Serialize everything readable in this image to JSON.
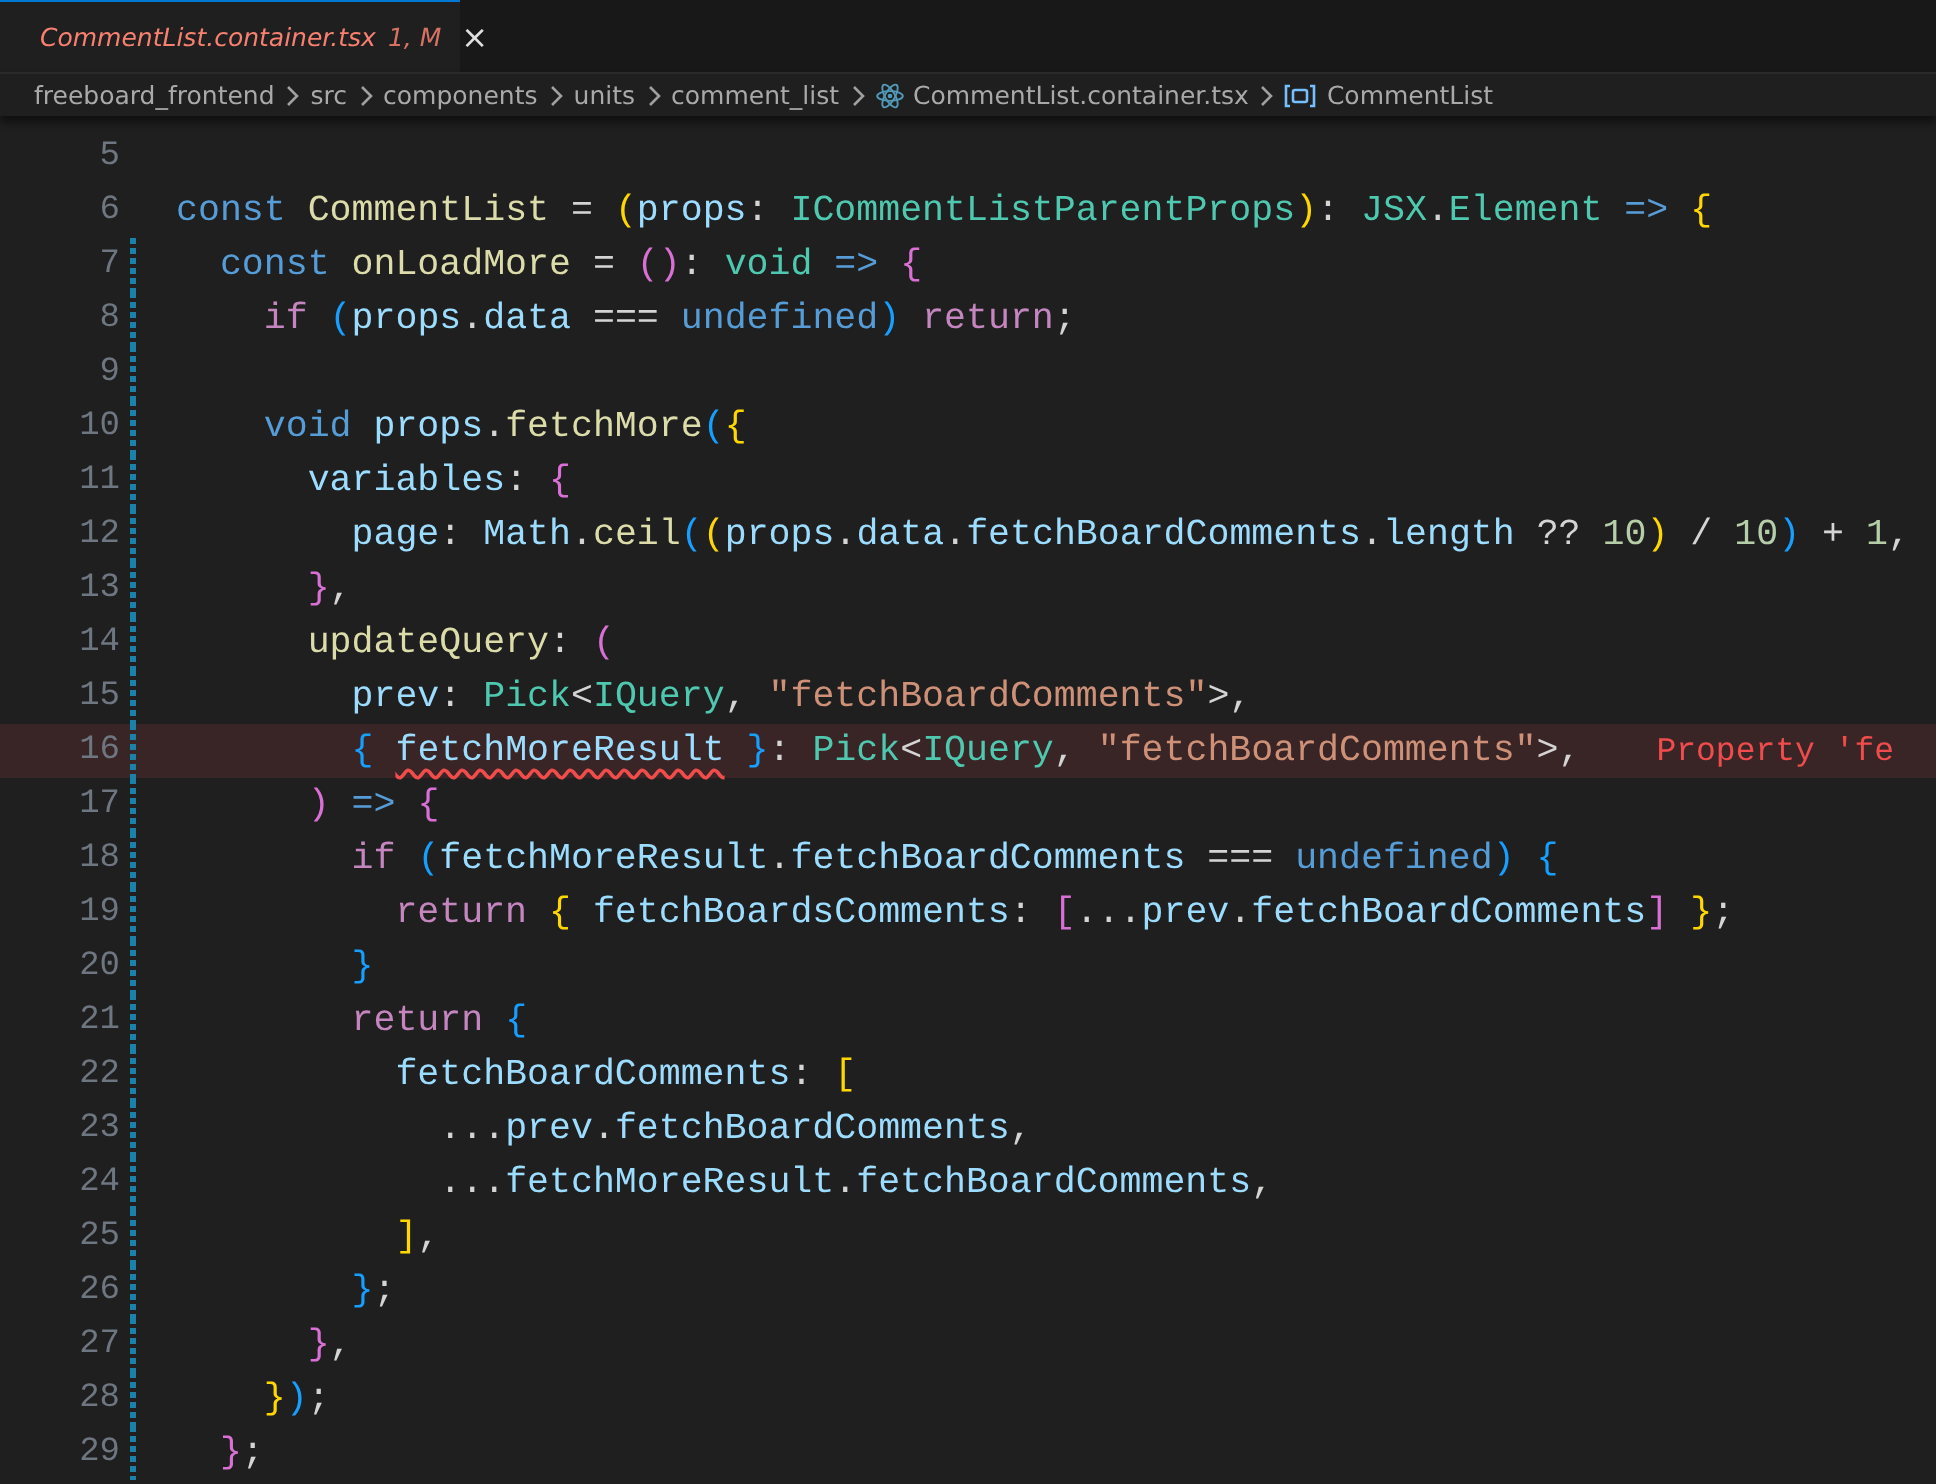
{
  "tab": {
    "title": "CommentList.container.tsx",
    "badge": "1, M",
    "close": "×",
    "selected": true
  },
  "breadcrumb": [
    {
      "label": "freeboard_frontend",
      "kind": "folder"
    },
    {
      "label": "src",
      "kind": "folder"
    },
    {
      "label": "components",
      "kind": "folder"
    },
    {
      "label": "units",
      "kind": "folder"
    },
    {
      "label": "comment_list",
      "kind": "folder"
    },
    {
      "label": "CommentList.container.tsx",
      "kind": "file"
    },
    {
      "label": "CommentList",
      "kind": "symbol"
    }
  ],
  "lines": [
    {
      "number": "5",
      "modified": false,
      "highlighted": false
    },
    {
      "number": "6",
      "modified": false,
      "highlighted": false,
      "tokens": [
        {
          "text": "const",
          "kind": "kw"
        },
        {
          "text": " CommentList",
          "kind": "fn"
        },
        {
          "text": " = ",
          "kind": "plain"
        },
        {
          "text": "(",
          "kind": "b1"
        },
        {
          "text": "props",
          "kind": "var"
        },
        {
          "text": ": ",
          "kind": "plain"
        },
        {
          "text": "ICommentListParentProps",
          "kind": "type"
        },
        {
          "text": ")",
          "kind": "b1"
        },
        {
          "text": ": ",
          "kind": "plain"
        },
        {
          "text": "JSX",
          "kind": "type"
        },
        {
          "text": ".",
          "kind": "plain"
        },
        {
          "text": "Element",
          "kind": "type"
        },
        {
          "text": " =>",
          "kind": "kw"
        },
        {
          "text": " {",
          "kind": "b1"
        }
      ]
    },
    {
      "number": "7",
      "modified": true,
      "highlighted": false,
      "tokens": [
        {
          "text": "  const",
          "kind": "kw"
        },
        {
          "text": " onLoadMore",
          "kind": "fn"
        },
        {
          "text": " = ",
          "kind": "plain"
        },
        {
          "text": "()",
          "kind": "b2"
        },
        {
          "text": ": ",
          "kind": "plain"
        },
        {
          "text": "void",
          "kind": "type"
        },
        {
          "text": " =>",
          "kind": "kw"
        },
        {
          "text": " {",
          "kind": "b2"
        }
      ]
    },
    {
      "number": "8",
      "modified": true,
      "highlighted": false,
      "tokens": [
        {
          "text": "    if",
          "kind": "ctl"
        },
        {
          "text": " (",
          "kind": "b3"
        },
        {
          "text": "props",
          "kind": "var"
        },
        {
          "text": ".",
          "kind": "plain"
        },
        {
          "text": "data",
          "kind": "var"
        },
        {
          "text": " === ",
          "kind": "plain"
        },
        {
          "text": "undefined",
          "kind": "kw"
        },
        {
          "text": ")",
          "kind": "b3"
        },
        {
          "text": " return",
          "kind": "ctl"
        },
        {
          "text": ";",
          "kind": "plain"
        }
      ]
    },
    {
      "number": "9",
      "modified": true,
      "highlighted": false
    },
    {
      "number": "10",
      "modified": true,
      "highlighted": false,
      "tokens": [
        {
          "text": "    void",
          "kind": "kw"
        },
        {
          "text": " props",
          "kind": "var"
        },
        {
          "text": ".",
          "kind": "plain"
        },
        {
          "text": "fetchMore",
          "kind": "fn"
        },
        {
          "text": "(",
          "kind": "b3"
        },
        {
          "text": "{",
          "kind": "b1"
        }
      ]
    },
    {
      "number": "11",
      "modified": true,
      "highlighted": false,
      "tokens": [
        {
          "text": "      variables",
          "kind": "var"
        },
        {
          "text": ": ",
          "kind": "plain"
        },
        {
          "text": "{",
          "kind": "b2"
        }
      ]
    },
    {
      "number": "12",
      "modified": true,
      "highlighted": false,
      "tokens": [
        {
          "text": "        page",
          "kind": "var"
        },
        {
          "text": ": ",
          "kind": "plain"
        },
        {
          "text": "Math",
          "kind": "var"
        },
        {
          "text": ".",
          "kind": "plain"
        },
        {
          "text": "ceil",
          "kind": "fn"
        },
        {
          "text": "(",
          "kind": "b3"
        },
        {
          "text": "(",
          "kind": "b1"
        },
        {
          "text": "props",
          "kind": "var"
        },
        {
          "text": ".",
          "kind": "plain"
        },
        {
          "text": "data",
          "kind": "var"
        },
        {
          "text": ".",
          "kind": "plain"
        },
        {
          "text": "fetchBoardComments",
          "kind": "var"
        },
        {
          "text": ".",
          "kind": "plain"
        },
        {
          "text": "length",
          "kind": "var"
        },
        {
          "text": " ?? ",
          "kind": "plain"
        },
        {
          "text": "10",
          "kind": "num"
        },
        {
          "text": ")",
          "kind": "b1"
        },
        {
          "text": " / ",
          "kind": "plain"
        },
        {
          "text": "10",
          "kind": "num"
        },
        {
          "text": ")",
          "kind": "b3"
        },
        {
          "text": " + ",
          "kind": "plain"
        },
        {
          "text": "1",
          "kind": "num"
        },
        {
          "text": ",",
          "kind": "plain"
        }
      ]
    },
    {
      "number": "13",
      "modified": true,
      "highlighted": false,
      "tokens": [
        {
          "text": "      }",
          "kind": "b2"
        },
        {
          "text": ",",
          "kind": "plain"
        }
      ]
    },
    {
      "number": "14",
      "modified": true,
      "highlighted": false,
      "tokens": [
        {
          "text": "      updateQuery",
          "kind": "fn"
        },
        {
          "text": ": ",
          "kind": "plain"
        },
        {
          "text": "(",
          "kind": "b2"
        }
      ]
    },
    {
      "number": "15",
      "modified": true,
      "highlighted": false,
      "tokens": [
        {
          "text": "        prev",
          "kind": "var"
        },
        {
          "text": ": ",
          "kind": "plain"
        },
        {
          "text": "Pick",
          "kind": "type"
        },
        {
          "text": "<",
          "kind": "plain"
        },
        {
          "text": "IQuery",
          "kind": "type"
        },
        {
          "text": ", ",
          "kind": "plain"
        },
        {
          "text": "\"fetchBoardComments\"",
          "kind": "str"
        },
        {
          "text": ">,",
          "kind": "plain"
        }
      ]
    },
    {
      "number": "16",
      "modified": true,
      "highlighted": true,
      "error": "Property 'fe",
      "tokens": [
        {
          "text": "        { ",
          "kind": "b3"
        },
        {
          "text": "fetchMoreResult",
          "kind": "err"
        },
        {
          "text": " }",
          "kind": "b3"
        },
        {
          "text": ": ",
          "kind": "plain"
        },
        {
          "text": "Pick",
          "kind": "type"
        },
        {
          "text": "<",
          "kind": "plain"
        },
        {
          "text": "IQuery",
          "kind": "type"
        },
        {
          "text": ", ",
          "kind": "plain"
        },
        {
          "text": "\"fetchBoardComments\"",
          "kind": "str"
        },
        {
          "text": ">,",
          "kind": "plain"
        }
      ]
    },
    {
      "number": "17",
      "modified": true,
      "highlighted": false,
      "tokens": [
        {
          "text": "      )",
          "kind": "b2"
        },
        {
          "text": " =>",
          "kind": "kw"
        },
        {
          "text": " {",
          "kind": "b2"
        }
      ]
    },
    {
      "number": "18",
      "modified": true,
      "highlighted": false,
      "tokens": [
        {
          "text": "        if",
          "kind": "ctl"
        },
        {
          "text": " (",
          "kind": "b3"
        },
        {
          "text": "fetchMoreResult",
          "kind": "var"
        },
        {
          "text": ".",
          "kind": "plain"
        },
        {
          "text": "fetchBoardComments",
          "kind": "var"
        },
        {
          "text": " === ",
          "kind": "plain"
        },
        {
          "text": "undefined",
          "kind": "kw"
        },
        {
          "text": ")",
          "kind": "b3"
        },
        {
          "text": " {",
          "kind": "b3"
        }
      ]
    },
    {
      "number": "19",
      "modified": true,
      "highlighted": false,
      "tokens": [
        {
          "text": "          return",
          "kind": "ctl"
        },
        {
          "text": " {",
          "kind": "b1"
        },
        {
          "text": " fetchBoardsComments",
          "kind": "var"
        },
        {
          "text": ": ",
          "kind": "plain"
        },
        {
          "text": "[",
          "kind": "b2"
        },
        {
          "text": "...",
          "kind": "plain"
        },
        {
          "text": "prev",
          "kind": "var"
        },
        {
          "text": ".",
          "kind": "plain"
        },
        {
          "text": "fetchBoardComments",
          "kind": "var"
        },
        {
          "text": "]",
          "kind": "b2"
        },
        {
          "text": " }",
          "kind": "b1"
        },
        {
          "text": ";",
          "kind": "plain"
        }
      ]
    },
    {
      "number": "20",
      "modified": true,
      "highlighted": false,
      "tokens": [
        {
          "text": "        }",
          "kind": "b3"
        }
      ]
    },
    {
      "number": "21",
      "modified": true,
      "highlighted": false,
      "tokens": [
        {
          "text": "        return",
          "kind": "ctl"
        },
        {
          "text": " {",
          "kind": "b3"
        }
      ]
    },
    {
      "number": "22",
      "modified": true,
      "highlighted": false,
      "tokens": [
        {
          "text": "          fetchBoardComments",
          "kind": "var"
        },
        {
          "text": ": ",
          "kind": "plain"
        },
        {
          "text": "[",
          "kind": "b1"
        }
      ]
    },
    {
      "number": "23",
      "modified": true,
      "highlighted": false,
      "tokens": [
        {
          "text": "            ...",
          "kind": "plain"
        },
        {
          "text": "prev",
          "kind": "var"
        },
        {
          "text": ".",
          "kind": "plain"
        },
        {
          "text": "fetchBoardComments",
          "kind": "var"
        },
        {
          "text": ",",
          "kind": "plain"
        }
      ]
    },
    {
      "number": "24",
      "modified": true,
      "highlighted": false,
      "tokens": [
        {
          "text": "            ...",
          "kind": "plain"
        },
        {
          "text": "fetchMoreResult",
          "kind": "var"
        },
        {
          "text": ".",
          "kind": "plain"
        },
        {
          "text": "fetchBoardComments",
          "kind": "var"
        },
        {
          "text": ",",
          "kind": "plain"
        }
      ]
    },
    {
      "number": "25",
      "modified": true,
      "highlighted": false,
      "tokens": [
        {
          "text": "          ]",
          "kind": "b1"
        },
        {
          "text": ",",
          "kind": "plain"
        }
      ]
    },
    {
      "number": "26",
      "modified": true,
      "highlighted": false,
      "tokens": [
        {
          "text": "        }",
          "kind": "b3"
        },
        {
          "text": ";",
          "kind": "plain"
        }
      ]
    },
    {
      "number": "27",
      "modified": true,
      "highlighted": false,
      "tokens": [
        {
          "text": "      }",
          "kind": "b2"
        },
        {
          "text": ",",
          "kind": "plain"
        }
      ]
    },
    {
      "number": "28",
      "modified": true,
      "highlighted": false,
      "tokens": [
        {
          "text": "    }",
          "kind": "b1"
        },
        {
          "text": ")",
          "kind": "b3"
        },
        {
          "text": ";",
          "kind": "plain"
        }
      ]
    },
    {
      "number": "29",
      "modified": true,
      "highlighted": false,
      "tokens": [
        {
          "text": "  }",
          "kind": "b2"
        },
        {
          "text": ";",
          "kind": "plain"
        }
      ]
    }
  ]
}
